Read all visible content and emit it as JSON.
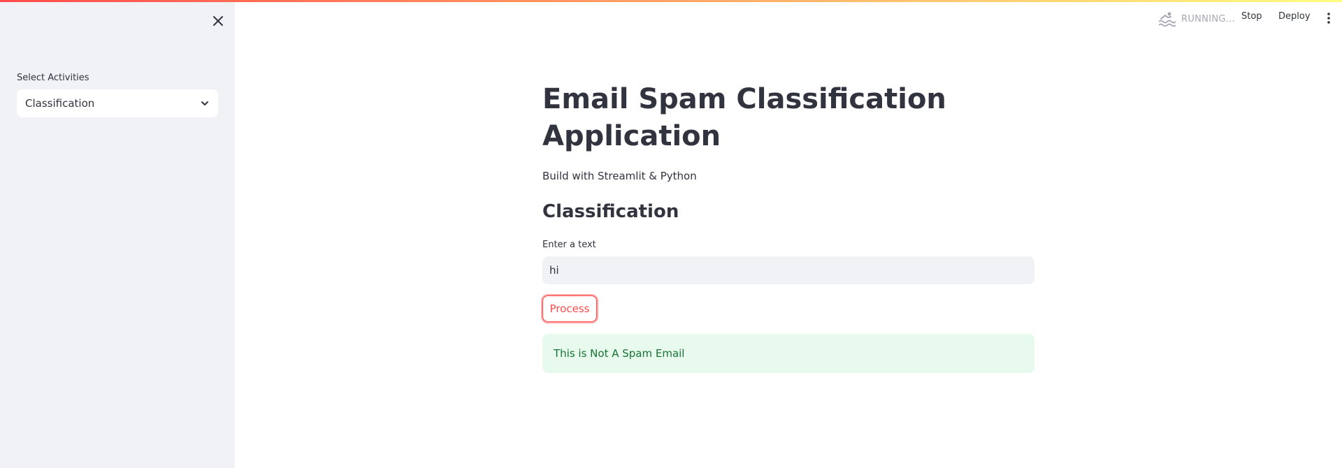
{
  "sidebar": {
    "select_label": "Select Activities",
    "select_value": "Classification"
  },
  "header": {
    "status": "RUNNING...",
    "stop_label": "Stop",
    "deploy_label": "Deploy"
  },
  "main": {
    "title": "Email Spam Classification Application",
    "subtitle": "Build with Streamlit & Python",
    "section_heading": "Classification",
    "input_label": "Enter a text",
    "input_value": "hi",
    "button_label": "Process",
    "result_message": "This is Not A Spam Email"
  },
  "colors": {
    "accent": "#ff4b4b",
    "sidebar_bg": "#f0f2f6",
    "success_bg": "#e8f9ee",
    "success_text": "#177233"
  }
}
